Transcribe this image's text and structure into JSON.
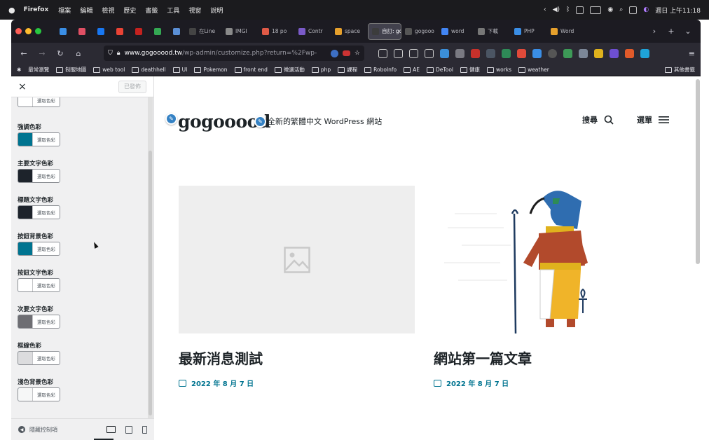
{
  "menubar": {
    "app_name": "Firefox",
    "items": [
      "檔案",
      "編輯",
      "檢視",
      "歷史",
      "書籤",
      "工具",
      "視窗",
      "說明"
    ],
    "clock": "週日 上午11:18",
    "status_icons": [
      "chevron-left-icon",
      "volume-icon",
      "bluetooth-icon",
      "input-us-icon",
      "battery-icon",
      "user-icon",
      "search-icon",
      "control-center-icon",
      "siri-icon"
    ]
  },
  "browser": {
    "tabs": [
      {
        "label": "",
        "pinned": true,
        "color": "#3a8ee6"
      },
      {
        "label": "",
        "pinned": true,
        "color": "#e04f64"
      },
      {
        "label": "",
        "pinned": true,
        "color": "#1877f2"
      },
      {
        "label": "",
        "pinned": true,
        "color": "#ea4335"
      },
      {
        "label": "",
        "pinned": true,
        "color": "#c5221f"
      },
      {
        "label": "",
        "pinned": true,
        "color": "#34a853"
      },
      {
        "label": "",
        "pinned": true,
        "color": "#5b8fd6"
      },
      {
        "label": "在Line",
        "color": "#444"
      },
      {
        "label": "IMGI",
        "color": "#8a8a8a"
      },
      {
        "label": "18 po",
        "color": "#e05a47"
      },
      {
        "label": "Contr",
        "color": "#7a5ac8"
      },
      {
        "label": "space",
        "color": "#e6a02c"
      },
      {
        "label": "自訂: gc",
        "color": "#3c3c3c",
        "active": true
      },
      {
        "label": "gogooo",
        "color": "#555"
      },
      {
        "label": "word",
        "color": "#4285f4"
      },
      {
        "label": "下載",
        "color": "#777"
      },
      {
        "label": "PHP",
        "color": "#3a8ee6"
      },
      {
        "label": "Word",
        "color": "#e6a02c"
      }
    ],
    "url_host": "www.gogooood.tw",
    "url_path": "/wp-admin/customize.php?return=%2Fwp-",
    "bookmarks": [
      "最常瀏覽",
      "制服地圖",
      "web tool",
      "deathhell",
      "UI",
      "Pokemon",
      "front end",
      "徵選活動",
      "php",
      "課程",
      "RoboInfo",
      "AE",
      "DeTool",
      "健康",
      "works",
      "weather"
    ],
    "other_bookmarks": "其他書籤"
  },
  "customizer": {
    "close_label": "×",
    "publish_label": "已發佈",
    "pick_label": "選取色彩",
    "settings": [
      {
        "label": "",
        "color": "#ffffff"
      },
      {
        "label": "強調色彩",
        "color": "#007490"
      },
      {
        "label": "主要文字色彩",
        "color": "#1d232b"
      },
      {
        "label": "標題文字色彩",
        "color": "#1d232b"
      },
      {
        "label": "按鈕背景色彩",
        "color": "#007490"
      },
      {
        "label": "按鈕文字色彩",
        "color": "#ffffff"
      },
      {
        "label": "次要文字色彩",
        "color": "#6e6e73"
      },
      {
        "label": "框線色彩",
        "color": "#dcdcde"
      },
      {
        "label": "淺色背景色彩",
        "color": "#f6f7f7"
      }
    ],
    "hide_controls_label": "隱藏控制項"
  },
  "site": {
    "title": "gogooood",
    "description": "全新的繁體中文 WordPress 網站",
    "search_label": "搜尋",
    "menu_label": "選單",
    "posts": [
      {
        "title": "最新消息測試",
        "date": "2022 年 8 月 7 日",
        "has_image": false
      },
      {
        "title": "網站第一篇文章",
        "date": "2022 年 8 月 7 日",
        "has_image": true
      }
    ]
  }
}
